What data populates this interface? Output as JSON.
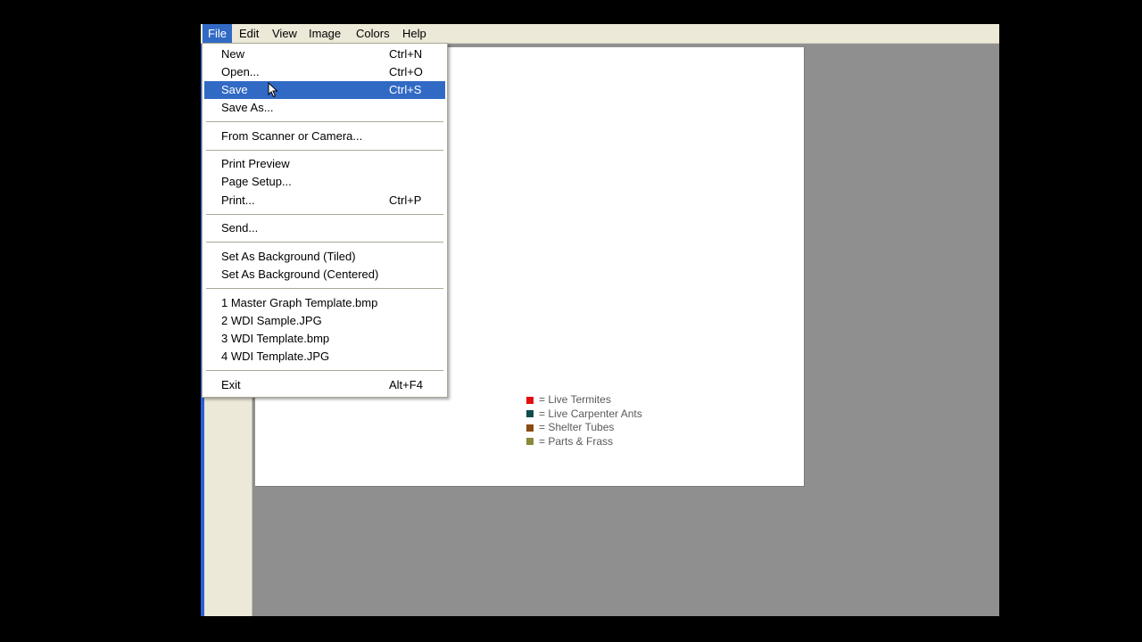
{
  "menubar": {
    "items": [
      {
        "label": "File"
      },
      {
        "label": "Edit"
      },
      {
        "label": "View"
      },
      {
        "label": "Image"
      },
      {
        "label": "Colors"
      },
      {
        "label": "Help"
      }
    ]
  },
  "file_menu": {
    "new": {
      "label": "New",
      "shortcut": "Ctrl+N"
    },
    "open": {
      "label": "Open...",
      "shortcut": "Ctrl+O"
    },
    "save": {
      "label": "Save",
      "shortcut": "Ctrl+S"
    },
    "save_as": {
      "label": "Save As..."
    },
    "from_scanner": {
      "label": "From Scanner or Camera..."
    },
    "print_preview": {
      "label": "Print Preview"
    },
    "page_setup": {
      "label": "Page Setup..."
    },
    "print": {
      "label": "Print...",
      "shortcut": "Ctrl+P"
    },
    "send": {
      "label": "Send..."
    },
    "bg_tiled": {
      "label": "Set As Background (Tiled)"
    },
    "bg_centered": {
      "label": "Set As Background (Centered)"
    },
    "recent": [
      {
        "label": "1 Master Graph Template.bmp"
      },
      {
        "label": "2 WDI Sample.JPG"
      },
      {
        "label": "3 WDI Template.bmp"
      },
      {
        "label": "4 WDI Template.JPG"
      }
    ],
    "exit": {
      "label": "Exit",
      "shortcut": "Alt+F4"
    }
  },
  "legend": {
    "items": [
      {
        "label": "= Live Termites",
        "color": "#e01010"
      },
      {
        "label": "= Live Carpenter Ants",
        "color": "#0e4d4d"
      },
      {
        "label": "= Shelter Tubes",
        "color": "#8a4a10"
      },
      {
        "label": "= Parts & Frass",
        "color": "#8a8a3a"
      }
    ]
  },
  "colors": {
    "highlight": "#316ac5",
    "menubar_bg": "#ece9d8",
    "workspace_bg": "#8f8f8f"
  }
}
